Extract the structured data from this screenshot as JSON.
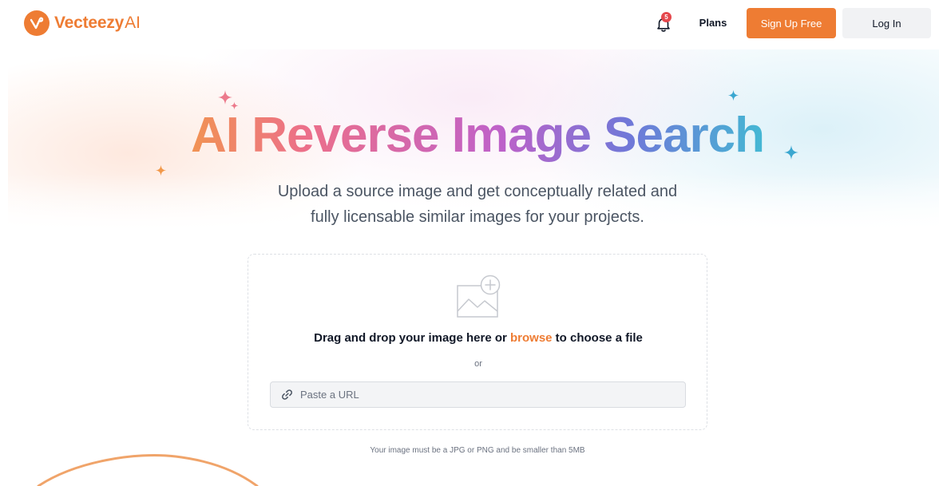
{
  "header": {
    "brand_name": "Vecteezy",
    "brand_suffix": "AI",
    "notification_count": "5",
    "plans_label": "Plans",
    "signup_label": "Sign Up Free",
    "login_label": "Log In"
  },
  "hero": {
    "title": "AI Reverse Image Search",
    "subtitle_line1": "Upload a source image and get conceptually related and",
    "subtitle_line2": "fully licensable similar images for your projects."
  },
  "upload": {
    "drop_prefix": "Drag and drop your image here or ",
    "browse_label": "browse",
    "drop_suffix": " to choose a file",
    "or_label": "or",
    "url_placeholder": "Paste a URL",
    "requirement_text": "Your image must be a JPG or PNG and be smaller than 5MB"
  },
  "colors": {
    "brand_orange": "#ee7c33",
    "badge_red": "#e5484d",
    "title_gradient": [
      "#f2994a",
      "#ec6f8a",
      "#c061c8",
      "#6f78d8",
      "#3ec1d3"
    ]
  },
  "icons": {
    "logo": "vecteezy-logo-icon",
    "notifications": "bell-icon",
    "upload": "image-add-icon",
    "url": "link-icon",
    "decor": "sparkle-icon"
  }
}
